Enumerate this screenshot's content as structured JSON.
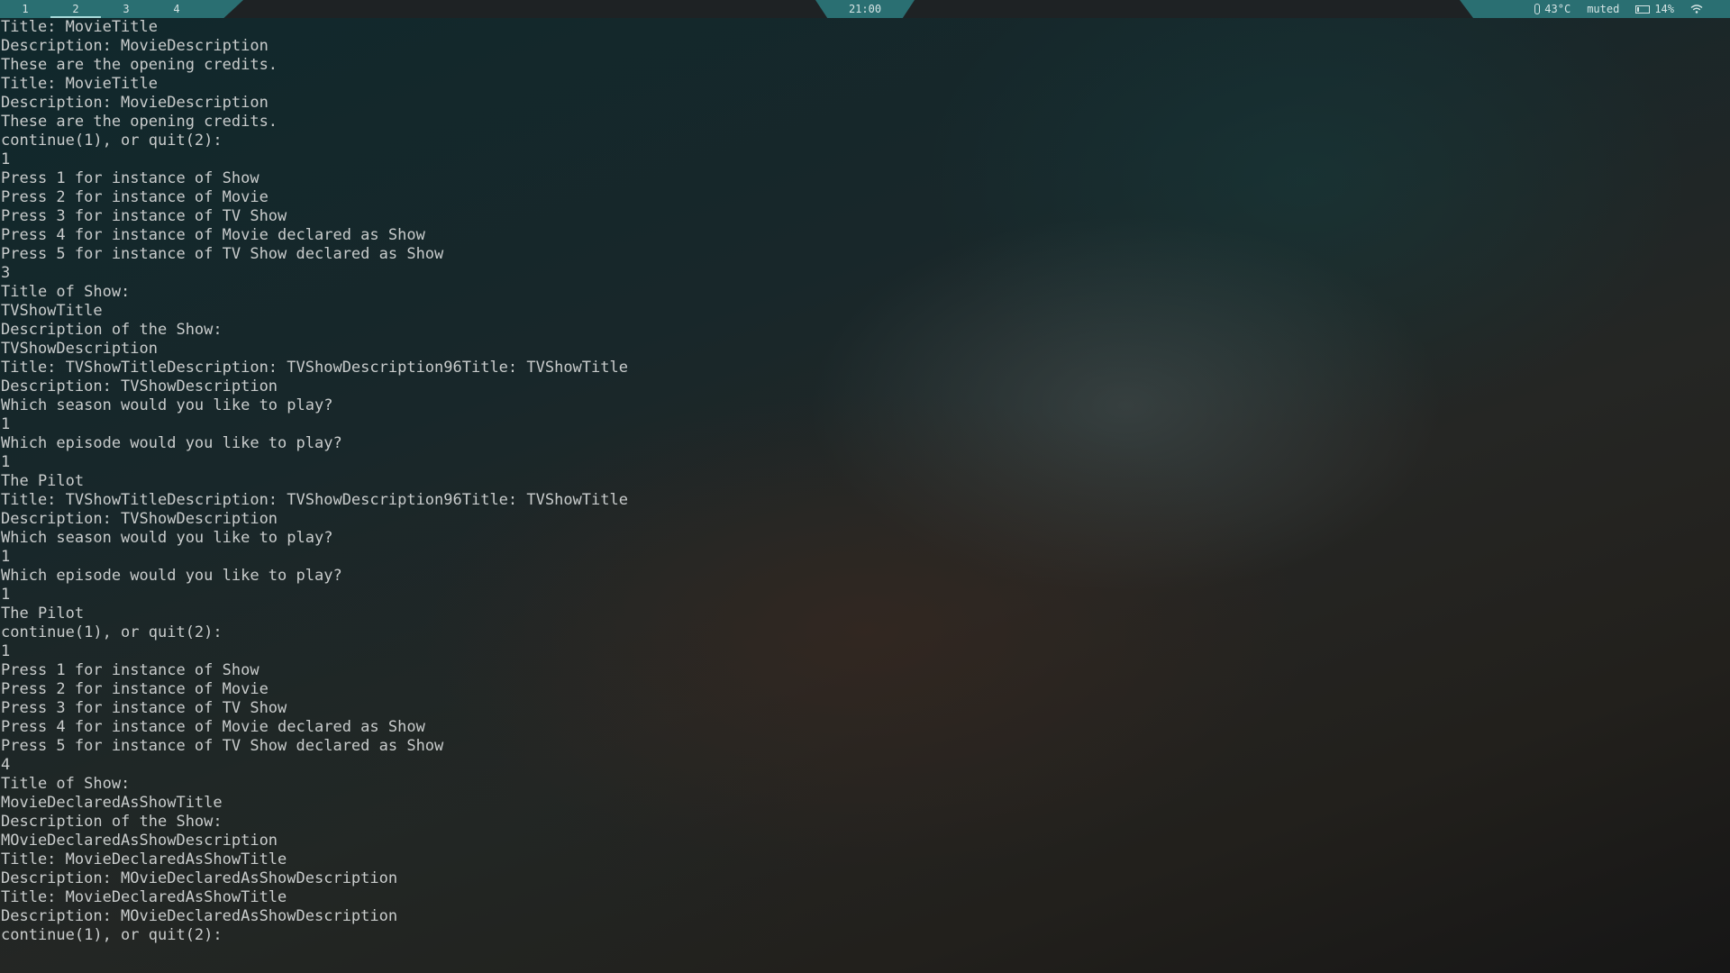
{
  "topbar": {
    "workspaces": [
      "1",
      "2",
      "3",
      "4"
    ],
    "active_workspace": "2",
    "clock": "21:00",
    "status": {
      "temperature": "43°C",
      "volume": "muted",
      "battery": "14%"
    },
    "icons": [
      "thermometer-icon",
      "battery-icon",
      "wifi-icon"
    ]
  },
  "terminal": {
    "lines": [
      "Title: MovieTitle",
      "Description: MovieDescription",
      "These are the opening credits.",
      "Title: MovieTitle",
      "Description: MovieDescription",
      "These are the opening credits.",
      "continue(1), or quit(2):",
      "1",
      "Press 1 for instance of Show",
      "Press 2 for instance of Movie",
      "Press 3 for instance of TV Show",
      "Press 4 for instance of Movie declared as Show",
      "Press 5 for instance of TV Show declared as Show",
      "3",
      "Title of Show:",
      "TVShowTitle",
      "Description of the Show:",
      "TVShowDescription",
      "Title: TVShowTitleDescription: TVShowDescription96Title: TVShowTitle",
      "Description: TVShowDescription",
      "Which season would you like to play?",
      "1",
      "Which episode would you like to play?",
      "1",
      "The Pilot",
      "Title: TVShowTitleDescription: TVShowDescription96Title: TVShowTitle",
      "Description: TVShowDescription",
      "Which season would you like to play?",
      "1",
      "Which episode would you like to play?",
      "1",
      "The Pilot",
      "continue(1), or quit(2):",
      "1",
      "Press 1 for instance of Show",
      "Press 2 for instance of Movie",
      "Press 3 for instance of TV Show",
      "Press 4 for instance of Movie declared as Show",
      "Press 5 for instance of TV Show declared as Show",
      "4",
      "Title of Show:",
      "MovieDeclaredAsShowTitle",
      "Description of the Show:",
      "MOvieDeclaredAsShowDescription",
      "Title: MovieDeclaredAsShowTitle",
      "Description: MOvieDeclaredAsShowDescription",
      "Title: MovieDeclaredAsShowTitle",
      "Description: MOvieDeclaredAsShowDescription",
      "continue(1), or quit(2):"
    ]
  },
  "colors": {
    "bar_accent": "#2a6f72",
    "terminal_text": "#c9cccc"
  }
}
